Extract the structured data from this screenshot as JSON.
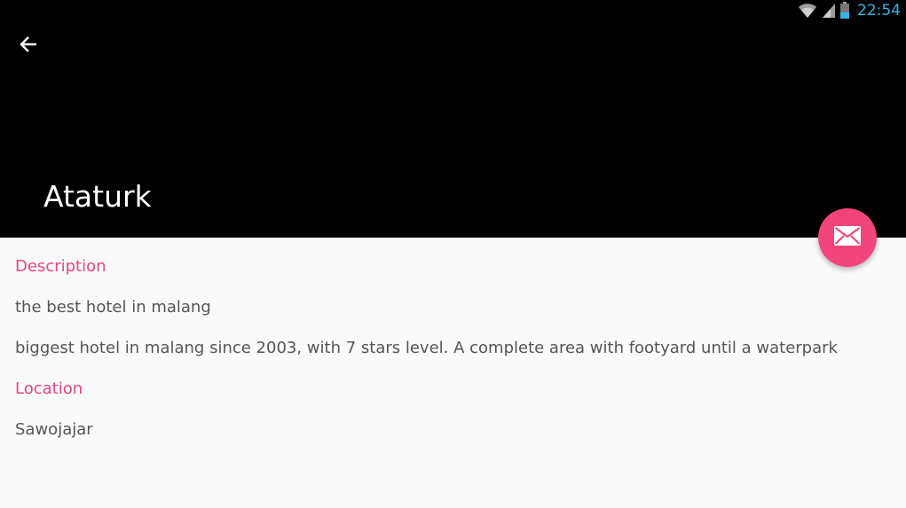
{
  "status_bar": {
    "time": "22:54",
    "icons": [
      "wifi-icon",
      "signal-icon",
      "battery-icon"
    ]
  },
  "toolbar": {
    "back_icon": "arrow-left-icon",
    "title": "Ataturk"
  },
  "fab": {
    "icon": "mail-icon",
    "color": "#f2457b"
  },
  "details": {
    "description_header": "Description",
    "subtitle": "the best hotel in malang",
    "description": "biggest hotel in malang since 2003, with 7 stars level. A complete area with footyard until a waterpark",
    "location_header": "Location",
    "location": "Sawojajar"
  },
  "colors": {
    "appbar": "#000000",
    "accent": "#e8457f",
    "status_time": "#33b5e5",
    "body_text": "#555555",
    "background": "#fafafa"
  }
}
